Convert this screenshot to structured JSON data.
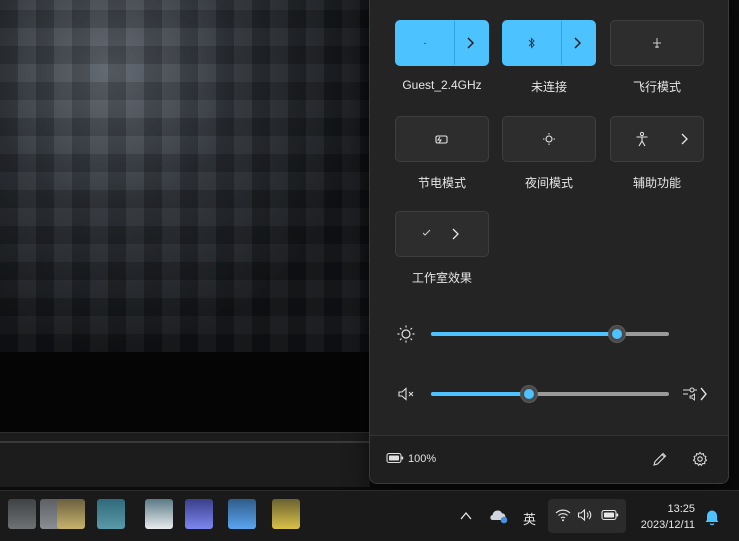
{
  "quick_settings": {
    "tiles": [
      {
        "label": "Guest_2.4GHz",
        "state": "on",
        "icon": "wifi-icon"
      },
      {
        "label": "未连接",
        "state": "on",
        "icon": "bluetooth-icon"
      },
      {
        "label": "飞行模式",
        "state": "off",
        "icon": "airplane-icon"
      },
      {
        "label": "节电模式",
        "state": "off",
        "icon": "battery-saver-icon"
      },
      {
        "label": "夜间模式",
        "state": "off",
        "icon": "night-light-icon"
      },
      {
        "label": "辅助功能",
        "state": "off",
        "icon": "accessibility-icon"
      },
      {
        "label": "工作室效果",
        "state": "off",
        "icon": "studio-effects-icon"
      }
    ],
    "brightness": {
      "icon": "sun-icon",
      "value": 0.78
    },
    "volume": {
      "icon": "speaker-muted-icon",
      "value": 0.41
    },
    "footer": {
      "battery_text": "100%",
      "battery_icon": "battery-icon"
    }
  },
  "taskbar": {
    "ime": "英",
    "clock_time": "13:25",
    "clock_date": "2023/12/11"
  },
  "colors": {
    "accent": "#4cc2ff",
    "panel": "#242424",
    "taskbar": "#1a1a1a"
  }
}
